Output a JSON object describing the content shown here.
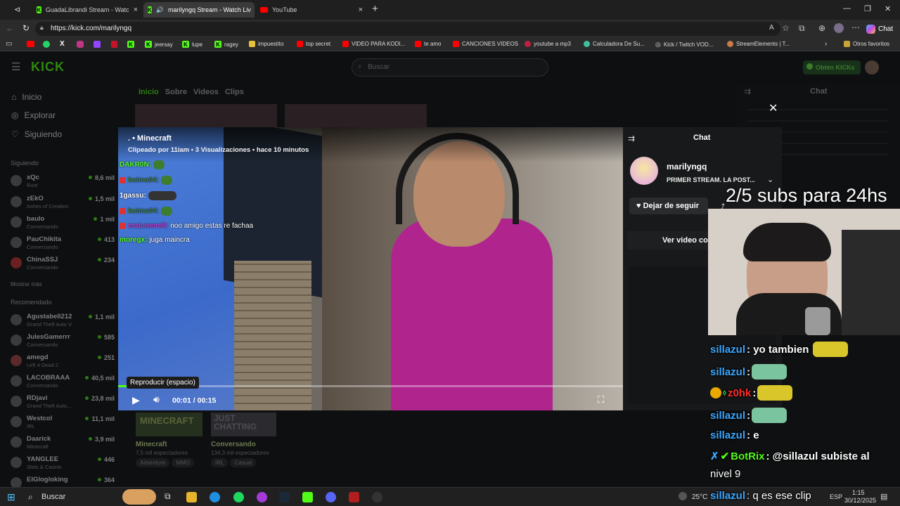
{
  "tabs": [
    {
      "title": "GuadaLibrandi Stream - Watc",
      "active": false,
      "icon": "kick-icon"
    },
    {
      "title": "marilyngq Stream - Watch Liv",
      "active": true,
      "icon": "kick-icon"
    },
    {
      "title": "YouTube",
      "active": false,
      "icon": "youtube-icon"
    }
  ],
  "address": {
    "url": "https://kick.com/marilyngq"
  },
  "browser": {
    "chat_button": "Chat"
  },
  "bookmarks": [
    "jeersay",
    "lupe",
    "ragey",
    "impuestito",
    "top secret",
    "VIDEO PARA KODI...",
    "te amo",
    "CANCIONES VIDEOS",
    "youtube a mp3",
    "Calculadora De Su...",
    "Kick / Twitch VOD...",
    "StreamElements | T...",
    "Otros favoritos"
  ],
  "kick": {
    "search_placeholder": "Buscar",
    "get_kicks": "Obtén KICKs",
    "nav": [
      {
        "label": "Inicio",
        "icon": "home-icon"
      },
      {
        "label": "Explorar",
        "icon": "compass-icon"
      },
      {
        "label": "Siguiendo",
        "icon": "heart-icon"
      }
    ],
    "following_header": "Siguiendo",
    "following": [
      {
        "name": "xQc",
        "sub": "Rust",
        "viewers": "8,6 mil"
      },
      {
        "name": "zEkO",
        "sub": "Ashes of Creation",
        "viewers": "1,5 mil"
      },
      {
        "name": "baulo",
        "sub": "Conversando",
        "viewers": "1 mil"
      },
      {
        "name": "PauChikita",
        "sub": "Conversando",
        "viewers": "413"
      },
      {
        "name": "ChinaSSJ",
        "sub": "Conversando",
        "viewers": "234"
      }
    ],
    "show_more": "Mostrar más",
    "recommended_header": "Recomendado",
    "recommended": [
      {
        "name": "Agustabell212",
        "sub": "Grand Theft Auto V",
        "viewers": "1,1 mil"
      },
      {
        "name": "JulesGamerrr",
        "sub": "Conversando",
        "viewers": "585"
      },
      {
        "name": "amegd",
        "sub": "Left 4 Dead 2",
        "viewers": "251"
      },
      {
        "name": "LACOBRAAA",
        "sub": "Conversando",
        "viewers": "40,5 mil"
      },
      {
        "name": "RDjavi",
        "sub": "Grand Theft Auto...",
        "viewers": "23,8 mil"
      },
      {
        "name": "Westcol",
        "sub": "IRL",
        "viewers": "11,1 mil"
      },
      {
        "name": "Daarick",
        "sub": "Minecraft",
        "viewers": "3,9 mil"
      },
      {
        "name": "YANGLEE",
        "sub": "Slots & Casino",
        "viewers": "446"
      },
      {
        "name": "ElGlogloking",
        "sub": "",
        "viewers": "364"
      }
    ],
    "channel_tabs": [
      "Inicio",
      "Sobre",
      "Videos",
      "Clips"
    ],
    "categories": [
      {
        "thumb": "MINECRAFT",
        "name": "Minecraft",
        "viewers": "7,5 mil espectadores",
        "tags": [
          "Adventure",
          "MMO"
        ]
      },
      {
        "thumb": "JUST CHATTING",
        "name": "Conversando",
        "viewers": "134,3 mil espectadores",
        "tags": [
          "IRL",
          "Casual"
        ]
      }
    ],
    "chat_title": "Chat"
  },
  "clip": {
    "title": "Minecraft",
    "meta": "Clipeado por 11iam • 3 Visualizaciones • hace 10 minutos",
    "tooltip": "Reproducir (espacio)",
    "time": "00:01 / 00:15",
    "progress": 0.067,
    "chat": [
      {
        "user": "DAKR0N:",
        "msg": "",
        "color": "#53fc18"
      },
      {
        "user": "kutma04:",
        "msg": "",
        "color": "#3c7d2e"
      },
      {
        "user": "1gassu:",
        "msg": "",
        "color": "#ffffff"
      },
      {
        "user": "kutma04:",
        "msg": "",
        "color": "#3c7d2e"
      },
      {
        "user": "matumorell:",
        "msg": "noo amigo estas re fachaa",
        "color": "#c03bd1"
      },
      {
        "user": "moregx:",
        "msg": "juga maincra",
        "color": "#53fc18"
      }
    ]
  },
  "modal_chat": {
    "header": "Chat",
    "streamer": "marilyngq",
    "stream_title": "PRIMER STREAM. LA POST...",
    "unfollow": "Dejar de seguir",
    "watch_video": "Ver video co"
  },
  "overlay": {
    "subs_goal": "2/5 subs para 24hs",
    "chat": [
      {
        "user": "sillazul",
        "msg": ": yo tambien",
        "color": "#3ba7ff"
      },
      {
        "user": "sillazul",
        "msg": ":",
        "color": "#3ba7ff"
      },
      {
        "user": "z0hk",
        "msg": ":",
        "color": "#ff2b2b"
      },
      {
        "user": "sillazul",
        "msg": ":",
        "color": "#3ba7ff"
      },
      {
        "user": "sillazul",
        "msg": ": e",
        "color": "#3ba7ff"
      },
      {
        "user": "BotRix",
        "msg": ": @sillazul subiste al",
        "color": "#53fc18"
      },
      {
        "user": "",
        "msg": "nivel 9",
        "color": "#ffffff"
      },
      {
        "user": "sillazul",
        "msg": ": q es ese clip",
        "color": "#3ba7ff"
      }
    ]
  },
  "taskbar": {
    "search": "Buscar",
    "temp": "25°C",
    "lang": "ESP",
    "time": "1:15",
    "date": "30/12/2025"
  }
}
